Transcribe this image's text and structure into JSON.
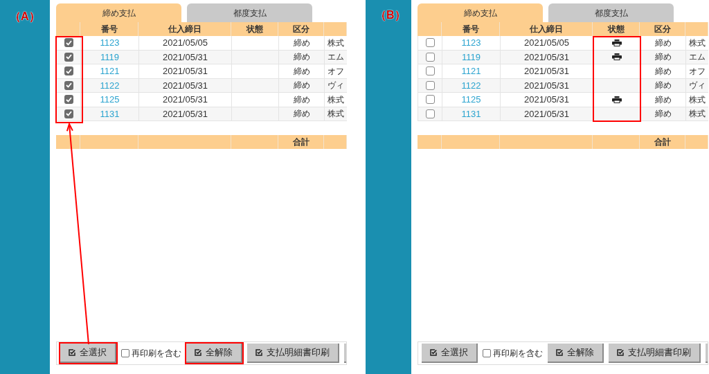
{
  "panels": [
    {
      "label": "（A）",
      "annotation_arrow": true,
      "tabs": [
        {
          "label": "締め支払",
          "selected": true
        },
        {
          "label": "都度支払",
          "selected": false
        }
      ],
      "table": {
        "checkbox_column_highlighted": true,
        "status_column_highlighted": false,
        "columns": [
          "番号",
          "仕入締日",
          "状態",
          "区分"
        ],
        "rows": [
          {
            "checked": true,
            "number": "1123",
            "date": "2021/05/05",
            "printed": false,
            "category": "締め",
            "column_6": "株式"
          },
          {
            "checked": true,
            "number": "1119",
            "date": "2021/05/31",
            "printed": false,
            "category": "締め",
            "column_6": "エム"
          },
          {
            "checked": true,
            "number": "1121",
            "date": "2021/05/31",
            "printed": false,
            "category": "締め",
            "column_6": "オフ"
          },
          {
            "checked": true,
            "number": "1122",
            "date": "2021/05/31",
            "printed": false,
            "category": "締め",
            "column_6": "ヴィ"
          },
          {
            "checked": true,
            "number": "1125",
            "date": "2021/05/31",
            "printed": false,
            "category": "締め",
            "column_6": "株式"
          },
          {
            "checked": true,
            "number": "1131",
            "date": "2021/05/31",
            "printed": false,
            "category": "締め",
            "column_6": "株式"
          }
        ],
        "footer": {
          "total_label": "合計"
        }
      },
      "toolbar": [
        {
          "kind": "button",
          "label": "全選択",
          "highlighted": true
        },
        {
          "kind": "checkbox",
          "label": "再印刷を含む",
          "checked": false
        },
        {
          "kind": "button",
          "label": "全解除",
          "highlighted": true
        },
        {
          "kind": "button",
          "label": "支払明細書印刷",
          "highlighted": false
        },
        {
          "kind": "cut_button"
        }
      ]
    },
    {
      "label": "（B）",
      "annotation_arrow": false,
      "tabs": [
        {
          "label": "締め支払",
          "selected": true
        },
        {
          "label": "都度支払",
          "selected": false
        }
      ],
      "table": {
        "checkbox_column_highlighted": false,
        "status_column_highlighted": true,
        "columns": [
          "番号",
          "仕入締日",
          "状態",
          "区分"
        ],
        "rows": [
          {
            "checked": false,
            "number": "1123",
            "date": "2021/05/05",
            "printed": true,
            "category": "締め",
            "column_6": "株式"
          },
          {
            "checked": false,
            "number": "1119",
            "date": "2021/05/31",
            "printed": true,
            "category": "締め",
            "column_6": "エム"
          },
          {
            "checked": false,
            "number": "1121",
            "date": "2021/05/31",
            "printed": false,
            "category": "締め",
            "column_6": "オフ"
          },
          {
            "checked": false,
            "number": "1122",
            "date": "2021/05/31",
            "printed": false,
            "category": "締め",
            "column_6": "ヴィ"
          },
          {
            "checked": false,
            "number": "1125",
            "date": "2021/05/31",
            "printed": true,
            "category": "締め",
            "column_6": "株式"
          },
          {
            "checked": false,
            "number": "1131",
            "date": "2021/05/31",
            "printed": false,
            "category": "締め",
            "column_6": "株式"
          }
        ],
        "footer": {
          "total_label": "合計"
        }
      },
      "toolbar": [
        {
          "kind": "button",
          "label": "全選択",
          "highlighted": false
        },
        {
          "kind": "checkbox",
          "label": "再印刷を含む",
          "checked": false
        },
        {
          "kind": "button",
          "label": "全解除",
          "highlighted": false
        },
        {
          "kind": "button",
          "label": "支払明細書印刷",
          "highlighted": false
        },
        {
          "kind": "cut_button"
        }
      ]
    }
  ]
}
